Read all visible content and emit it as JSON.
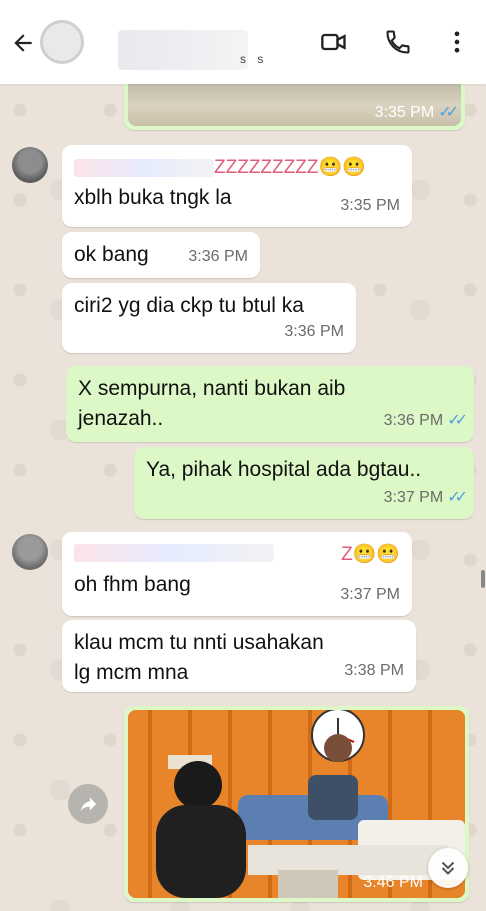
{
  "header": {
    "status_text": "s s",
    "icons": [
      "back-arrow-icon",
      "video-call-icon",
      "voice-call-icon",
      "more-vert-icon"
    ]
  },
  "messages": [
    {
      "dir": "out",
      "kind": "image",
      "time": "3:35 PM",
      "read": true
    },
    {
      "dir": "in",
      "sender_suffix": "ZZZZZZZZZ😬😬",
      "text": "xblh buka tngk la",
      "time": "3:35 PM"
    },
    {
      "dir": "in",
      "text": "ok bang",
      "time": "3:36 PM"
    },
    {
      "dir": "in",
      "text": "ciri2 yg dia ckp tu btul ka",
      "time": "3:36 PM"
    },
    {
      "dir": "out",
      "text": "X sempurna, nanti bukan aib jenazah..",
      "time": "3:36 PM",
      "read": true
    },
    {
      "dir": "out",
      "text": "Ya, pihak hospital ada bgtau..",
      "time": "3:37 PM",
      "read": true
    },
    {
      "dir": "in",
      "sender_suffix": "Z😬😬",
      "text": "oh fhm bang",
      "time": "3:37 PM"
    },
    {
      "dir": "in",
      "text": "klau mcm tu nnti usahakan lg mcm mna",
      "time": "3:38 PM"
    },
    {
      "dir": "out",
      "kind": "image",
      "time": "3:46 PM"
    }
  ],
  "read_ticks": "✓✓",
  "colors": {
    "outgoing": "#dcf8c6",
    "incoming": "#ffffff",
    "tick_blue": "#4fa3e0",
    "sender_name": "#e05c7a"
  }
}
